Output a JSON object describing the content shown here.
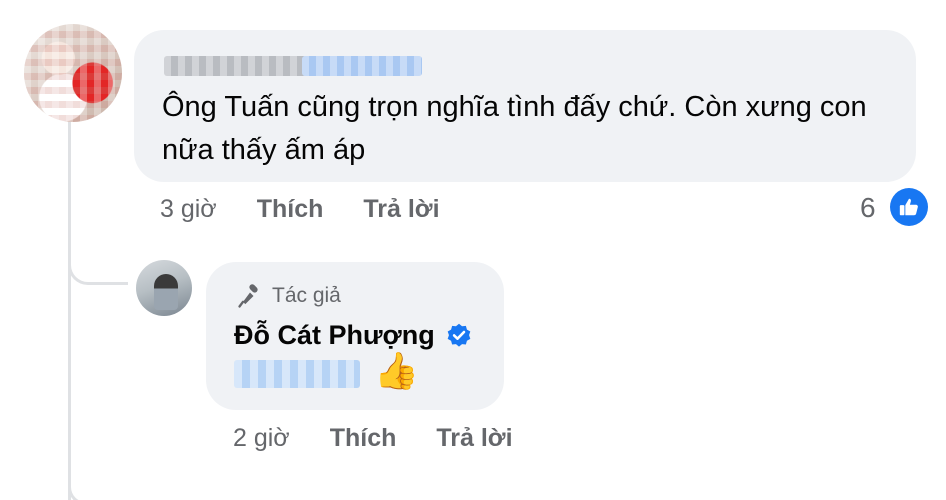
{
  "top_comment": {
    "text": "Ông Tuấn cũng trọn nghĩa tình đấy chứ. Còn xưng con nữa thấy ấm áp",
    "time": "3 giờ",
    "like_label": "Thích",
    "reply_label": "Trả lời",
    "reaction_count": "6",
    "reaction_icon": "like-icon"
  },
  "reply_comment": {
    "badge_label": "Tác giả",
    "badge_icon": "microphone-icon",
    "author_name": "Đỗ Cát Phượng",
    "verified_icon": "verified-badge-icon",
    "emoji": "👍",
    "time": "2 giờ",
    "like_label": "Thích",
    "reply_label": "Trả lời"
  },
  "colors": {
    "bubble": "#f0f2f5",
    "secondary_text": "#65676b",
    "brand_blue": "#1877f2",
    "thread_line": "#dfe1e4"
  }
}
